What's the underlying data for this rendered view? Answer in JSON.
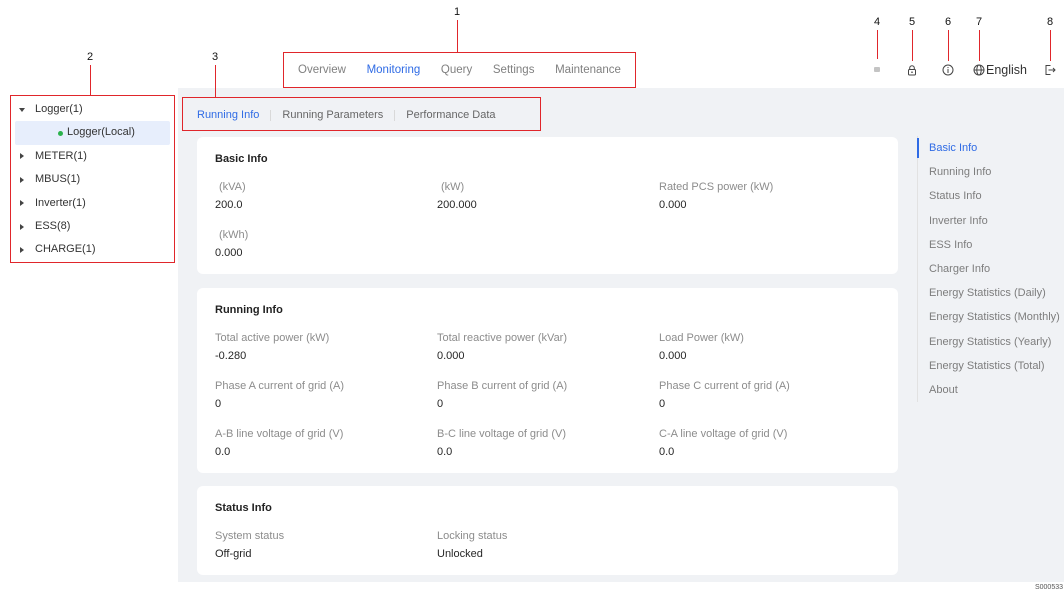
{
  "callouts": [
    "1",
    "2",
    "3",
    "4",
    "5",
    "6",
    "7",
    "8"
  ],
  "header": {
    "nav_tabs": [
      {
        "label": "Overview",
        "active": false
      },
      {
        "label": "Monitoring",
        "active": true
      },
      {
        "label": "Query",
        "active": false
      },
      {
        "label": "Settings",
        "active": false
      },
      {
        "label": "Maintenance",
        "active": false
      }
    ],
    "toolbar": {
      "alarm_icon": "alarm-icon",
      "lock_icon": "lock-icon",
      "help_icon": "info-icon",
      "language_icon": "globe-icon",
      "language": "English",
      "logout_icon": "logout-icon"
    }
  },
  "sidebar": {
    "tree": [
      {
        "label": "Logger(1)",
        "expanded": true,
        "children": [
          {
            "label": "Logger(Local)",
            "selected": true,
            "status": "online"
          }
        ]
      },
      {
        "label": "METER(1)",
        "expanded": false
      },
      {
        "label": "MBUS(1)",
        "expanded": false
      },
      {
        "label": "Inverter(1)",
        "expanded": false
      },
      {
        "label": "ESS(8)",
        "expanded": false
      },
      {
        "label": "CHARGE(1)",
        "expanded": false
      }
    ]
  },
  "main": {
    "sub_tabs": [
      {
        "label": "Running Info",
        "active": true
      },
      {
        "label": "Running Parameters",
        "active": false
      },
      {
        "label": "Performance Data",
        "active": false
      }
    ],
    "cards": [
      {
        "title": "Basic Info",
        "fields": [
          {
            "label": "(kVA)",
            "value": "200.0"
          },
          {
            "label": "(kW)",
            "value": "200.000"
          },
          {
            "label": "Rated PCS power (kW)",
            "value": "0.000"
          },
          {
            "label": "(kWh)",
            "value": "0.000"
          }
        ]
      },
      {
        "title": "Running Info",
        "fields": [
          {
            "label": "Total active power (kW)",
            "value": "-0.280"
          },
          {
            "label": "Total reactive power (kVar)",
            "value": "0.000"
          },
          {
            "label": "Load Power (kW)",
            "value": "0.000"
          },
          {
            "label": "Phase A current of grid (A)",
            "value": "0"
          },
          {
            "label": "Phase B current of grid (A)",
            "value": "0"
          },
          {
            "label": "Phase C current of grid (A)",
            "value": "0"
          },
          {
            "label": "A-B line voltage of grid (V)",
            "value": "0.0"
          },
          {
            "label": "B-C line voltage of grid (V)",
            "value": "0.0"
          },
          {
            "label": "C-A line voltage of grid (V)",
            "value": "0.0"
          }
        ]
      },
      {
        "title": "Status Info",
        "fields": [
          {
            "label": "System status",
            "value": "Off-grid"
          },
          {
            "label": "Locking status",
            "value": "Unlocked"
          }
        ]
      }
    ],
    "anchor_nav": [
      {
        "label": "Basic Info",
        "active": true
      },
      {
        "label": "Running Info",
        "active": false
      },
      {
        "label": "Status Info",
        "active": false
      },
      {
        "label": "Inverter Info",
        "active": false
      },
      {
        "label": "ESS Info",
        "active": false
      },
      {
        "label": "Charger Info",
        "active": false
      },
      {
        "label": "Energy Statistics (Daily)",
        "active": false
      },
      {
        "label": "Energy Statistics (Monthly)",
        "active": false
      },
      {
        "label": "Energy Statistics (Yearly)",
        "active": false
      },
      {
        "label": "Energy Statistics (Total)",
        "active": false
      },
      {
        "label": "About",
        "active": false
      }
    ]
  },
  "figure_id": "S000533",
  "colors": {
    "accent": "#2f6be5",
    "annotation": "#e0262b",
    "status_online": "#2bb24c",
    "selected_bg": "#e7eefc",
    "content_bg": "#f0f2f5"
  }
}
